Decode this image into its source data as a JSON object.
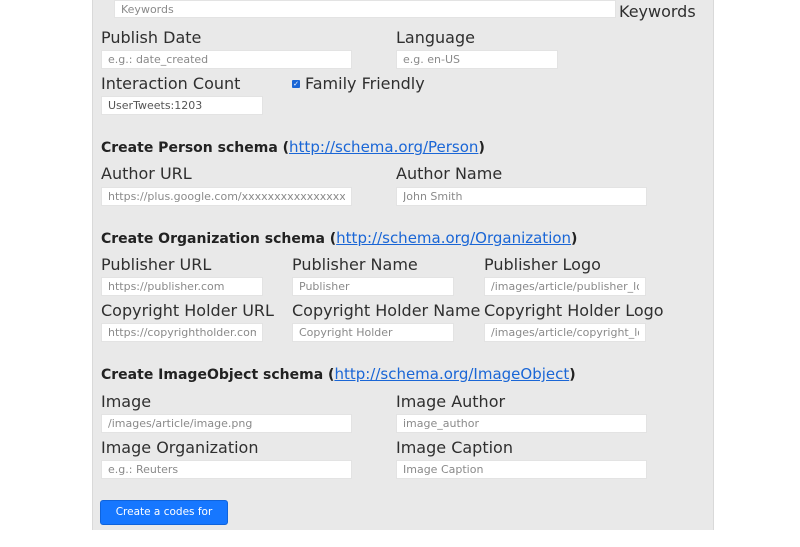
{
  "keywords": {
    "placeholder": "Keywords",
    "label": "Keywords"
  },
  "publish_date": {
    "label": "Publish Date",
    "placeholder": "e.g.: date_created"
  },
  "language": {
    "label": "Language",
    "placeholder": "e.g. en-US"
  },
  "interaction_count": {
    "label": "Interaction Count",
    "value": "UserTweets:1203"
  },
  "family_friendly": {
    "label": "Family Friendly",
    "checked": true
  },
  "person": {
    "heading": "Create Person schema (",
    "link": "http://schema.org/Person",
    "heading_end": ")",
    "author_url": {
      "label": "Author URL",
      "placeholder": "https://plus.google.com/xxxxxxxxxxxxxxxxxxxxx"
    },
    "author_name": {
      "label": "Author Name",
      "placeholder": "John Smith"
    }
  },
  "organization": {
    "heading": "Create Organization schema (",
    "link": "http://schema.org/Organization",
    "heading_end": ")",
    "publisher_url": {
      "label": "Publisher URL",
      "placeholder": "https://publisher.com"
    },
    "publisher_name": {
      "label": "Publisher Name",
      "placeholder": "Publisher"
    },
    "publisher_logo": {
      "label": "Publisher Logo",
      "placeholder": "/images/article/publisher_logo.png"
    },
    "copyright_url": {
      "label": "Copyright Holder URL",
      "placeholder": "https://copyrightholder.com"
    },
    "copyright_name": {
      "label": "Copyright Holder Name",
      "placeholder": "Copyright Holder"
    },
    "copyright_logo": {
      "label": "Copyright Holder Logo",
      "placeholder": "/images/article/copyright_logo.png"
    }
  },
  "image_object": {
    "heading": "Create ImageObject schema (",
    "link": "http://schema.org/ImageObject",
    "heading_end": ")",
    "image": {
      "label": "Image",
      "placeholder": "/images/article/image.png"
    },
    "image_author": {
      "label": "Image Author",
      "placeholder": "image_author"
    },
    "image_org": {
      "label": "Image Organization",
      "placeholder": "e.g.: Reuters"
    },
    "image_caption": {
      "label": "Image Caption",
      "placeholder": "Image Caption"
    }
  },
  "submit_label": "Create a codes for article",
  "colors": {
    "link": "#1a66d6",
    "button": "#1677ff",
    "panel": "#e9e9e9"
  }
}
